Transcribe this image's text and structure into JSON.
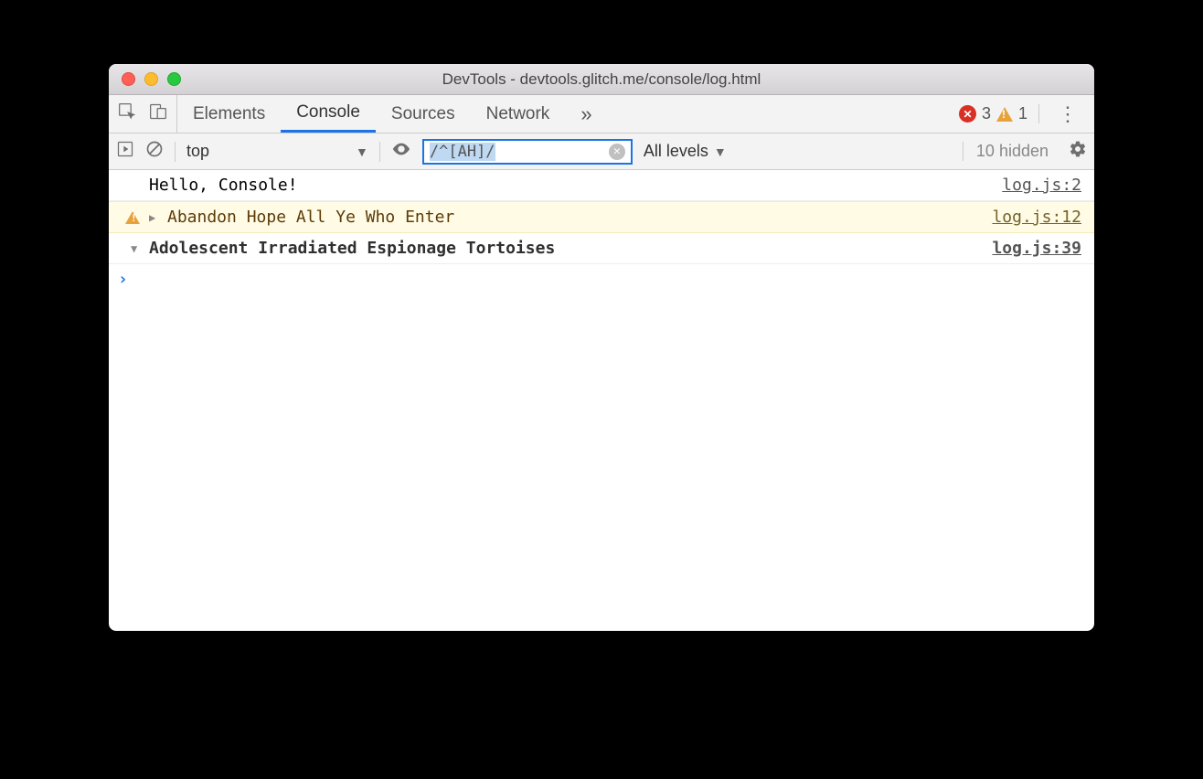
{
  "window": {
    "title": "DevTools - devtools.glitch.me/console/log.html"
  },
  "tabs": {
    "elements": "Elements",
    "console": "Console",
    "sources": "Sources",
    "network": "Network",
    "overflow": "»"
  },
  "status": {
    "error_count": "3",
    "warning_count": "1"
  },
  "toolbar": {
    "context": "top",
    "filter_value": "/^[AH]/",
    "levels_label": "All levels",
    "hidden_label": "10 hidden"
  },
  "logs": [
    {
      "type": "log",
      "text": "Hello, Console!",
      "source": "log.js:2"
    },
    {
      "type": "warn",
      "text": "Abandon Hope All Ye Who Enter",
      "source": "log.js:12"
    },
    {
      "type": "group",
      "text": "Adolescent Irradiated Espionage Tortoises",
      "source": "log.js:39"
    }
  ]
}
